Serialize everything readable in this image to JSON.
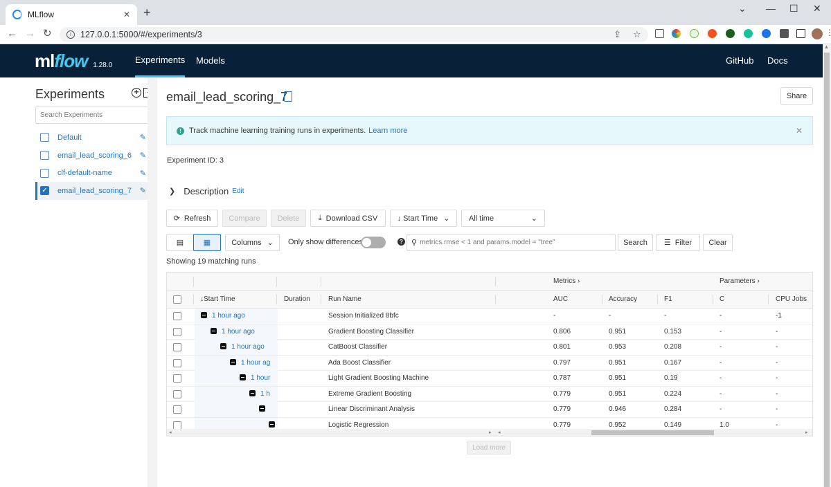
{
  "browser": {
    "tab_title": "MLflow",
    "url": "127.0.0.1:5000/#/experiments/3"
  },
  "header": {
    "logo_ml": "ml",
    "logo_flow": "flow",
    "version": "1.28.0",
    "nav": [
      "Experiments",
      "Models"
    ],
    "right_links": [
      "GitHub",
      "Docs"
    ]
  },
  "sidebar": {
    "title": "Experiments",
    "search_placeholder": "Search Experiments",
    "items": [
      {
        "label": "Default",
        "checked": false
      },
      {
        "label": "email_lead_scoring_6",
        "checked": false
      },
      {
        "label": "clf-default-name",
        "checked": false
      },
      {
        "label": "email_lead_scoring_7",
        "checked": true
      }
    ]
  },
  "main": {
    "title": "email_lead_scoring_7",
    "share_label": "Share",
    "banner_text": "Track machine learning training runs in experiments.",
    "banner_link": "Learn more",
    "experiment_id_label": "Experiment ID:",
    "experiment_id": "3",
    "description_label": "Description",
    "description_edit": "Edit",
    "toolbar": {
      "refresh": "Refresh",
      "compare": "Compare",
      "delete": "Delete",
      "download": "Download CSV",
      "sort": "Start Time",
      "time_range": "All time",
      "columns": "Columns",
      "only_diff": "Only show differences",
      "search_placeholder": "metrics.rmse < 1 and params.model = \"tree\"",
      "search_btn": "Search",
      "filter_btn": "Filter",
      "clear_btn": "Clear"
    },
    "showing": "Showing 19 matching runs",
    "grid": {
      "group_metrics": "Metrics",
      "group_params": "Parameters",
      "columns": [
        "Start Time",
        "Duration",
        "Run Name",
        "AUC",
        "Accuracy",
        "F1",
        "C",
        "CPU Jobs"
      ],
      "rows": [
        {
          "time": "1 hour ago",
          "name": "Session Initialized 8bfc",
          "auc": "-",
          "acc": "-",
          "f1": "-",
          "c": "-",
          "cpu": "-1"
        },
        {
          "time": "1 hour ago",
          "name": "Gradient Boosting Classifier",
          "auc": "0.806",
          "acc": "0.951",
          "f1": "0.153",
          "c": "-",
          "cpu": "-"
        },
        {
          "time": "1 hour ago",
          "name": "CatBoost Classifier",
          "auc": "0.801",
          "acc": "0.953",
          "f1": "0.208",
          "c": "-",
          "cpu": "-"
        },
        {
          "time": "1 hour ag",
          "name": "Ada Boost Classifier",
          "auc": "0.797",
          "acc": "0.951",
          "f1": "0.167",
          "c": "-",
          "cpu": "-"
        },
        {
          "time": "1 hour",
          "name": "Light Gradient Boosting Machine",
          "auc": "0.787",
          "acc": "0.951",
          "f1": "0.19",
          "c": "-",
          "cpu": "-"
        },
        {
          "time": "1 h",
          "name": "Extreme Gradient Boosting",
          "auc": "0.779",
          "acc": "0.951",
          "f1": "0.224",
          "c": "-",
          "cpu": "-"
        },
        {
          "time": "",
          "name": "Linear Discriminant Analysis",
          "auc": "0.779",
          "acc": "0.946",
          "f1": "0.284",
          "c": "-",
          "cpu": "-"
        },
        {
          "time": "",
          "name": "Logistic Regression",
          "auc": "0.779",
          "acc": "0.952",
          "f1": "0.149",
          "c": "1.0",
          "cpu": "-"
        }
      ]
    },
    "load_more": "Load more"
  },
  "colors": {
    "header_bg": "#082138",
    "accent": "#43c9ed",
    "link": "#2374bb"
  }
}
